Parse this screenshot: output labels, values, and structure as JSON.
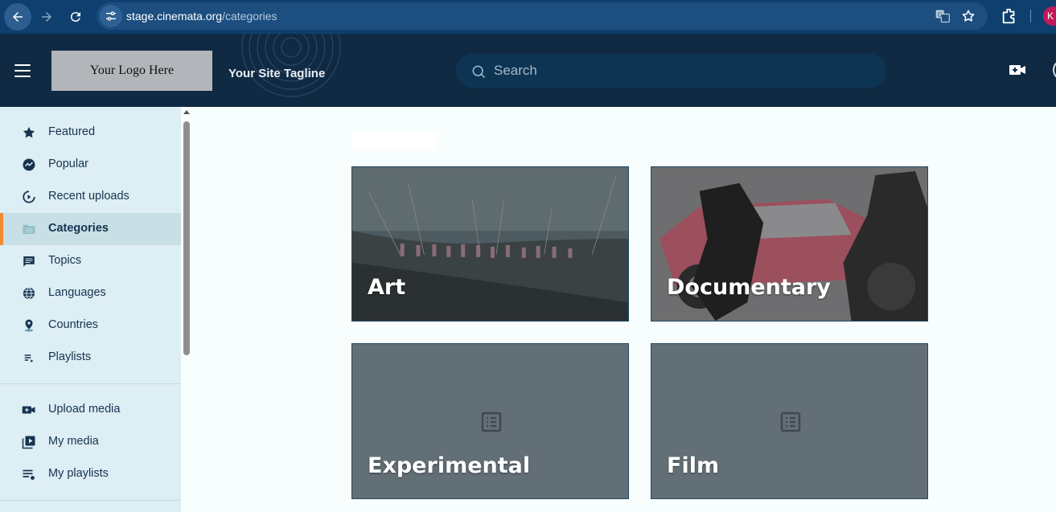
{
  "browser": {
    "url_domain": "stage.cinemata.org",
    "url_path": "/categories",
    "profile_initial": "K"
  },
  "header": {
    "logo_text": "Your Logo Here",
    "tagline": "Your Site Tagline",
    "search_placeholder": "Search"
  },
  "sidebar": {
    "items": [
      {
        "label": "Featured",
        "icon": "star-icon"
      },
      {
        "label": "Popular",
        "icon": "trending-icon"
      },
      {
        "label": "Recent uploads",
        "icon": "recent-icon"
      },
      {
        "label": "Categories",
        "icon": "folder-icon",
        "active": true
      },
      {
        "label": "Topics",
        "icon": "chat-icon"
      },
      {
        "label": "Languages",
        "icon": "globe-icon"
      },
      {
        "label": "Countries",
        "icon": "location-pin-icon"
      },
      {
        "label": "Playlists",
        "icon": "playlist-icon"
      }
    ],
    "user_items": [
      {
        "label": "Upload media",
        "icon": "video-add-icon"
      },
      {
        "label": "My media",
        "icon": "my-media-icon"
      },
      {
        "label": "My playlists",
        "icon": "playlist-add-icon"
      }
    ]
  },
  "main": {
    "categories": [
      {
        "title": "Art",
        "has_thumbnail": true
      },
      {
        "title": "Documentary",
        "has_thumbnail": true
      },
      {
        "title": "Experimental",
        "has_thumbnail": false
      },
      {
        "title": "Film",
        "has_thumbnail": false
      }
    ]
  },
  "colors": {
    "browser_bar": "#0e3f6e",
    "header_bg": "#102a43",
    "sidebar_bg": "#ddeef4",
    "active_accent": "#f28a30",
    "card_placeholder": "#636f76"
  }
}
